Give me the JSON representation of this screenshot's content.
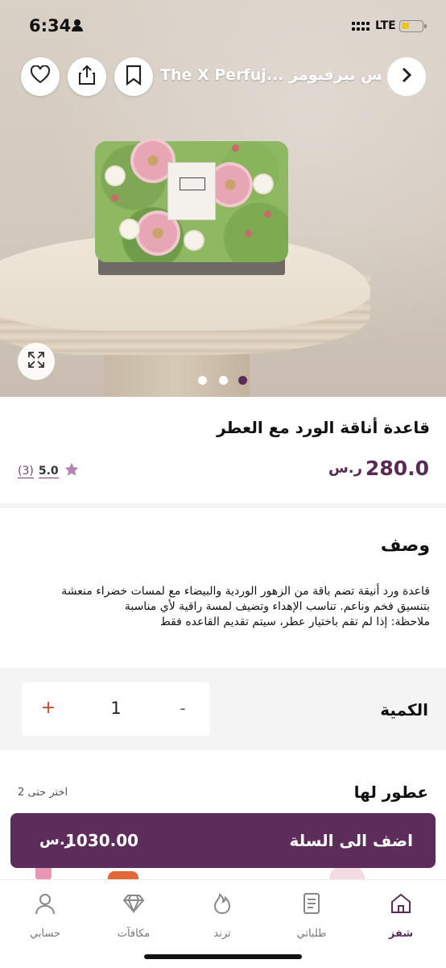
{
  "status_bar": {
    "time": "6:34",
    "network": "LTE"
  },
  "header": {
    "store_name": "The X Perfuj... اكس بيرفيومز",
    "icons": [
      "heart-icon",
      "share-icon",
      "bookmark-icon",
      "chevron-right-icon"
    ]
  },
  "gallery": {
    "slide_count": 3,
    "active_slide": 3,
    "expand_icon": "expand-icon"
  },
  "product": {
    "title": "قاعدة أناقة الورد مع العطر",
    "price": "280.0",
    "currency_symbol": "ر.س",
    "rating": {
      "score": "5.0",
      "count": "(3)"
    }
  },
  "description": {
    "heading": "وصف",
    "lines": [
      "قاعدة ورد أنيقة تضم باقة من الزهور الوردية والبيضاء مع لمسات خضراء منعشة",
      "بتنسيق فخم وناعم. تناسب الإهداء وتضيف لمسة راقية لأي مناسبة",
      "ملاحظة: إذا لم تقم باختيار عطر، سيتم تقديم القاعده فقط"
    ]
  },
  "quantity": {
    "label": "الكمية",
    "value": "1",
    "plus": "+",
    "minus": "-"
  },
  "perfumes": {
    "heading": "عطور لها",
    "hint": "اختر حتى 2"
  },
  "cart": {
    "label": "اضف الى السلة",
    "total": "1030.00",
    "currency_symbol": "ر.س"
  },
  "tabbar": {
    "items": [
      {
        "label": "شفز",
        "icon": "home-icon",
        "active": true
      },
      {
        "label": "طلباتي",
        "icon": "orders-icon",
        "active": false
      },
      {
        "label": "ترند",
        "icon": "flame-icon",
        "active": false
      },
      {
        "label": "مكافآت",
        "icon": "diamond-icon",
        "active": false
      },
      {
        "label": "حسابي",
        "icon": "user-icon",
        "active": false
      }
    ]
  },
  "colors": {
    "brand": "#5e2c5a",
    "accent_plus": "#d0472f",
    "rating_star": "#b384b3"
  }
}
